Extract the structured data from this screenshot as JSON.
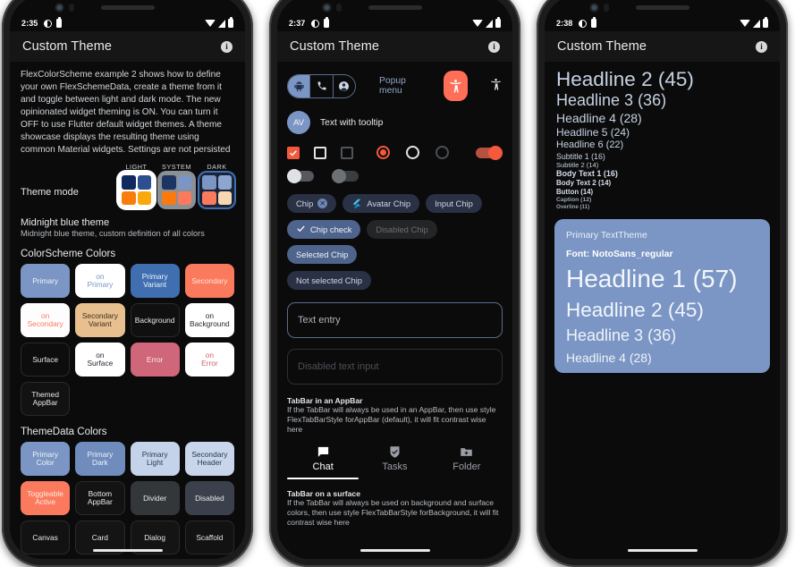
{
  "phones": [
    {
      "status": {
        "time": "2:35",
        "icons_left": [
          "do-not-disturb-icon",
          "sim-icon"
        ],
        "icons_right": [
          "wifi-icon",
          "signal-icon",
          "battery-icon"
        ]
      },
      "appbar": {
        "title": "Custom Theme",
        "info_label": "i"
      },
      "intro": "FlexColorScheme example 2 shows how to define your own FlexSchemeData, create a theme from it and toggle between light and dark mode. The new opinionated widget theming is ON. You can turn it OFF to use Flutter default widget themes. A theme showcase displays the resulting theme using common Material widgets. Settings are not persisted",
      "theme_mode": {
        "label": "Theme mode",
        "options": [
          {
            "caption": "LIGHT",
            "selected": true,
            "frame": "#ffffff",
            "bg": "#ffffff",
            "cells": [
              "#102a60",
              "#2d4f8f",
              "#f97d0c",
              "#f9a90c"
            ]
          },
          {
            "caption": "SYSTEM",
            "selected": false,
            "frame": "#8b8f96",
            "bg": "#8b8f96",
            "cells": [
              "#1b3464",
              "#7b96c4",
              "#fa7a10",
              "#fb7a5e"
            ]
          },
          {
            "caption": "DARK",
            "selected": false,
            "frame": "#3f6fb0",
            "bg": "#1a2438",
            "cells": [
              "#7b96c4",
              "#8da6cf",
              "#fb7a5e",
              "#f5d8b2"
            ]
          }
        ]
      },
      "scheme": {
        "title": "Midnight blue theme",
        "subtitle": "Midnight blue theme, custom definition of all colors"
      },
      "colorscheme_heading": "ColorScheme Colors",
      "colorscheme_swatches": [
        {
          "label": "Primary",
          "bg": "#7b96c4",
          "fg": "#f0f3f8",
          "border": false
        },
        {
          "label": "on\nPrimary",
          "bg": "#ffffff",
          "fg": "#7b96c4",
          "border": false
        },
        {
          "label": "Primary\nVariant",
          "bg": "#3f6fb0",
          "fg": "#eef3fa",
          "border": false
        },
        {
          "label": "Secondary",
          "bg": "#fb7a5e",
          "fg": "#fde5de",
          "border": false
        },
        {
          "label": "on\nSecondary",
          "bg": "#fdfdfd",
          "fg": "#fb7a5e",
          "border": false
        },
        {
          "label": "Secondary\nVariant",
          "bg": "#e8c08f",
          "fg": "#3c3021",
          "border": false
        },
        {
          "label": "Background",
          "bg": "#101010",
          "fg": "#e6e8eb",
          "border": true
        },
        {
          "label": "on\nBackground",
          "bg": "#ffffff",
          "fg": "#26292e",
          "border": false
        },
        {
          "label": "Surface",
          "bg": "#0d0d0d",
          "fg": "#e6e8eb",
          "border": true
        },
        {
          "label": "on\nSurface",
          "bg": "#ffffff",
          "fg": "#26292e",
          "border": false
        },
        {
          "label": "Error",
          "bg": "#cf6679",
          "fg": "#fbe9ed",
          "border": false
        },
        {
          "label": "on\nError",
          "bg": "#ffffff",
          "fg": "#cf6679",
          "border": false
        },
        {
          "label": "Themed\nAppBar",
          "bg": "#121212",
          "fg": "#e6e8eb",
          "border": true
        }
      ],
      "themedata_heading": "ThemeData Colors",
      "themedata_swatches": [
        {
          "label": "Primary\nColor",
          "bg": "#7b96c4",
          "fg": "#f0f3f8",
          "border": false
        },
        {
          "label": "Primary\nDark",
          "bg": "#6f8cbd",
          "fg": "#eef2f8",
          "border": false
        },
        {
          "label": "Primary\nLight",
          "bg": "#c5d3ea",
          "fg": "#2a3a52",
          "border": false
        },
        {
          "label": "Secondary\nHeader",
          "bg": "#c8d5ea",
          "fg": "#2a3a52",
          "border": false
        },
        {
          "label": "Toggleable\nActive",
          "bg": "#fb7a5e",
          "fg": "#fdeae4",
          "border": false
        },
        {
          "label": "Bottom\nAppBar",
          "bg": "#131313",
          "fg": "#e6e8eb",
          "border": true
        },
        {
          "label": "Divider",
          "bg": "#34373a",
          "fg": "#e6e8eb",
          "border": false
        },
        {
          "label": "Disabled",
          "bg": "#3b414c",
          "fg": "#e6e8eb",
          "border": false
        },
        {
          "label": "Canvas",
          "bg": "#121212",
          "fg": "#e6e8eb",
          "border": true
        },
        {
          "label": "Card",
          "bg": "#141414",
          "fg": "#e6e8eb",
          "border": true
        },
        {
          "label": "Dialog",
          "bg": "#141414",
          "fg": "#e6e8eb",
          "border": true
        },
        {
          "label": "Scaffold",
          "bg": "#121212",
          "fg": "#e6e8eb",
          "border": true
        }
      ]
    },
    {
      "status": {
        "time": "2:37"
      },
      "appbar": {
        "title": "Custom Theme",
        "info_label": "i"
      },
      "segmented": [
        {
          "icon": "android-icon",
          "selected": true
        },
        {
          "icon": "phone-icon",
          "selected": false
        },
        {
          "icon": "account-icon",
          "selected": false
        }
      ],
      "popup_menu_label": "Popup menu",
      "fab_icon": "accessibility-icon",
      "plain_icon": "accessibility-icon",
      "avatar_text": "AV",
      "tooltip_label": "Text with tooltip",
      "checkboxes": [
        {
          "state": "checked"
        },
        {
          "state": "unchecked"
        },
        {
          "state": "disabled"
        }
      ],
      "radios": [
        {
          "state": "selected"
        },
        {
          "state": "unselected"
        },
        {
          "state": "disabled"
        }
      ],
      "switch_top": {
        "state": "on"
      },
      "switches": [
        {
          "state": "off"
        },
        {
          "state": "disabled"
        }
      ],
      "chips_row1": [
        {
          "label": "Chip",
          "kind": "delete"
        },
        {
          "label": "Avatar Chip",
          "kind": "avatar"
        },
        {
          "label": "Input Chip",
          "kind": "plain"
        }
      ],
      "chips_row2": [
        {
          "label": "Chip check",
          "kind": "check"
        },
        {
          "label": "Disabled Chip",
          "kind": "disabled"
        },
        {
          "label": "Selected Chip",
          "kind": "selected"
        }
      ],
      "chips_row3": [
        {
          "label": "Not selected Chip",
          "kind": "plain"
        }
      ],
      "text_entry": {
        "placeholder": "Text entry",
        "value": ""
      },
      "disabled_text_input": {
        "placeholder": "Disabled text input",
        "value": ""
      },
      "tabbar_appbar": {
        "title": "TabBar in an AppBar",
        "desc": "If the TabBar will always be used in an AppBar, then use style FlexTabBarStyle forAppBar (default), it will fit contrast wise here",
        "tabs": [
          {
            "label": "Chat",
            "icon": "chat-icon",
            "selected": true
          },
          {
            "label": "Tasks",
            "icon": "tasks-shield-icon",
            "selected": false
          },
          {
            "label": "Folder",
            "icon": "folder-add-icon",
            "selected": false
          }
        ]
      },
      "tabbar_surface": {
        "title": "TabBar on a surface",
        "desc": "If the TabBar will always be used on background and surface colors, then use style FlexTabBarStyle forBackground, it will fit contrast wise here"
      }
    },
    {
      "status": {
        "time": "2:38"
      },
      "appbar": {
        "title": "Custom Theme",
        "info_label": "i"
      },
      "typography": [
        {
          "text": "Headline 2 (45)",
          "size": 22.5,
          "color": "#c6d2e2",
          "weight": "300"
        },
        {
          "text": "Headline 3 (36)",
          "size": 18.0,
          "color": "#c6d2e2",
          "weight": "300"
        },
        {
          "text": "Headline 4 (28)",
          "size": 14.0,
          "color": "#c6d2e2",
          "weight": "400"
        },
        {
          "text": "Headline 5 (24)",
          "size": 12.0,
          "color": "#c6d2e2",
          "weight": "400"
        },
        {
          "text": "Headline 6 (22)",
          "size": 11.0,
          "color": "#c6d2e2",
          "weight": "500"
        },
        {
          "text": "Subtitle 1 (16)",
          "size": 8.8,
          "color": "#c6d2e2",
          "weight": "500"
        },
        {
          "text": "Subtitle 2 (14)",
          "size": 7.6,
          "color": "#c6d2e2",
          "weight": "500"
        },
        {
          "text": "Body Text 1 (16)",
          "size": 9.0,
          "color": "#d4dcea",
          "weight": "700"
        },
        {
          "text": "Body Text 2 (14)",
          "size": 8.0,
          "color": "#d4dcea",
          "weight": "700"
        },
        {
          "text": "Button (14)",
          "size": 7.8,
          "color": "#d4dcea",
          "weight": "700"
        },
        {
          "text": "Caption (12)",
          "size": 6.8,
          "color": "#9aa3af",
          "weight": "600"
        },
        {
          "text": "Overline (11)",
          "size": 6.2,
          "color": "#9aa3af",
          "weight": "600"
        }
      ],
      "primary_card": {
        "bg": "#7b96c4",
        "title": "Primary TextTheme",
        "font": "Font: NotoSans_regular",
        "lines": [
          {
            "text": "Headline 1 (57)",
            "size": 28.0,
            "color": "#f2f6fb",
            "weight": "300"
          },
          {
            "text": "Headline 2 (45)",
            "size": 22.5,
            "color": "#f2f6fb",
            "weight": "300"
          },
          {
            "text": "Headline 3 (36)",
            "size": 18.0,
            "color": "#eef3f9",
            "weight": "300"
          },
          {
            "text": "Headline 4 (28)",
            "size": 14.0,
            "color": "#eef3f9",
            "weight": "400"
          }
        ]
      }
    }
  ]
}
